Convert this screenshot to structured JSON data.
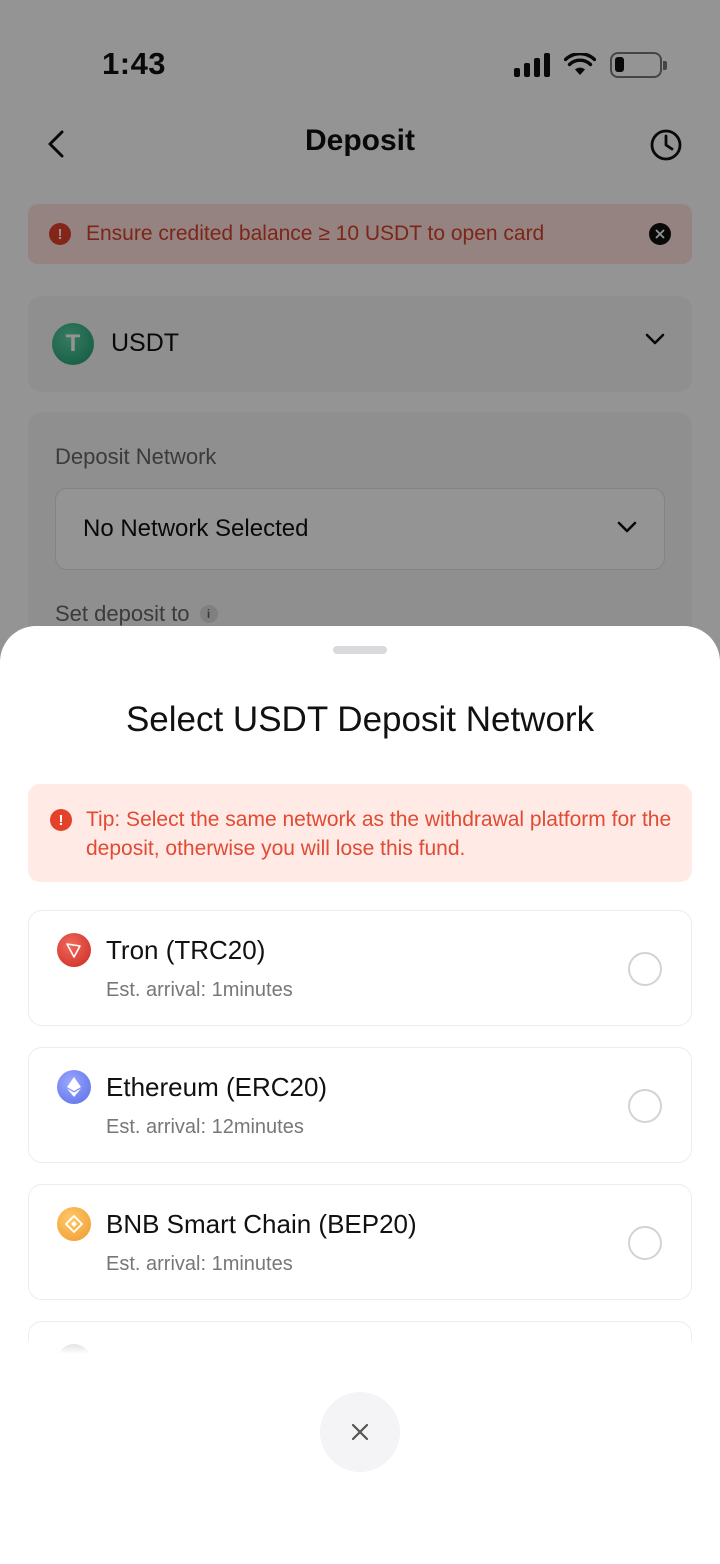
{
  "status_bar": {
    "time": "1:43"
  },
  "nav": {
    "title": "Deposit"
  },
  "notice": {
    "text": "Ensure credited balance ≥ 10 USDT to open card"
  },
  "coin": {
    "name": "USDT",
    "logo_letter": "T"
  },
  "deposit_network": {
    "label": "Deposit Network",
    "selected": "No Network Selected",
    "set_deposit_label": "Set deposit to"
  },
  "sheet": {
    "title": "Select USDT Deposit Network",
    "tip": "Tip: Select the same network as the withdrawal platform for the deposit, otherwise you will lose this fund.",
    "networks": [
      {
        "name": "Tron (TRC20)",
        "eta": "Est. arrival: 1minutes",
        "icon": "tron-icon",
        "color": "#d9362b"
      },
      {
        "name": "Ethereum (ERC20)",
        "eta": "Est. arrival: 12minutes",
        "icon": "ethereum-icon",
        "color": "#6b7ff0"
      },
      {
        "name": "BNB Smart Chain (BEP20)",
        "eta": "Est. arrival: 1minutes",
        "icon": "bnb-icon",
        "color": "#f0a33a"
      }
    ]
  },
  "colors": {
    "accent_red": "#e4412b",
    "notice_bg": "#ffe2dc",
    "tip_text": "#e24a33"
  }
}
